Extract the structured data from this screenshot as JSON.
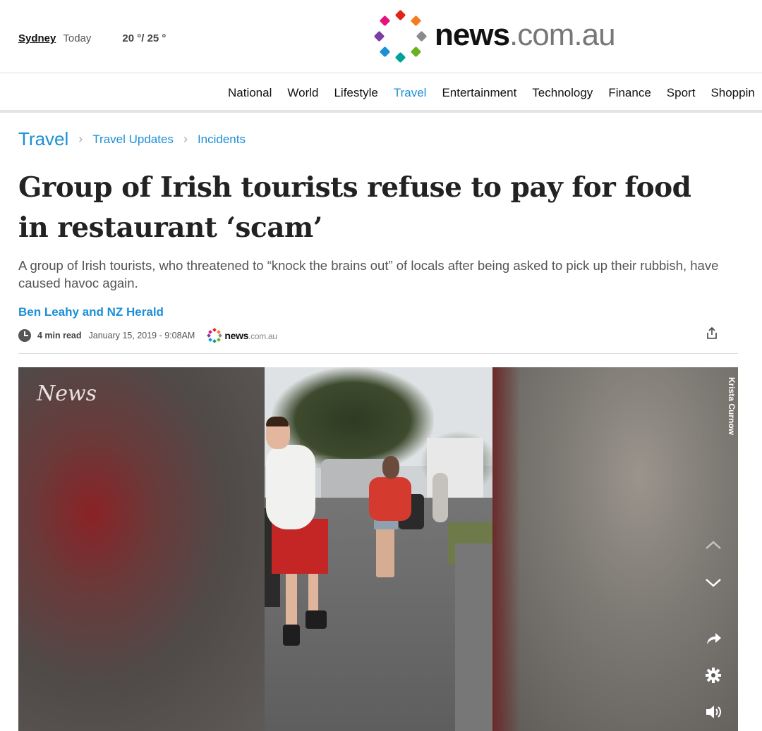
{
  "header": {
    "weather": {
      "city": "Sydney",
      "day": "Today",
      "temp": "20 °/ 25 °"
    },
    "logo": {
      "main": "news",
      "domain": ".com.au"
    }
  },
  "nav": {
    "items": [
      "National",
      "World",
      "Lifestyle",
      "Travel",
      "Entertainment",
      "Technology",
      "Finance",
      "Sport",
      "Shoppin"
    ],
    "active": "Travel",
    "active_color": "#1c8fd6"
  },
  "breadcrumb": [
    "Travel",
    "Travel Updates",
    "Incidents"
  ],
  "article": {
    "title": "Group of Irish tourists refuse to pay for food in restaurant ‘scam’",
    "standfirst": "A group of Irish tourists, who threatened to “knock the brains out” of locals after being asked to pick up their rubbish, have caused havoc again.",
    "byline": "Ben Leahy and NZ Herald",
    "read_time": "4 min read",
    "date": "January 15, 2019 - 9:08AM",
    "source_logo": {
      "main": "news",
      "domain": ".com.au"
    }
  },
  "video": {
    "watermark": "News",
    "credit": "Krista Curnow",
    "controls": [
      "chevron-up-icon",
      "chevron-down-icon",
      "share-icon",
      "gear-icon",
      "volume-icon"
    ]
  }
}
